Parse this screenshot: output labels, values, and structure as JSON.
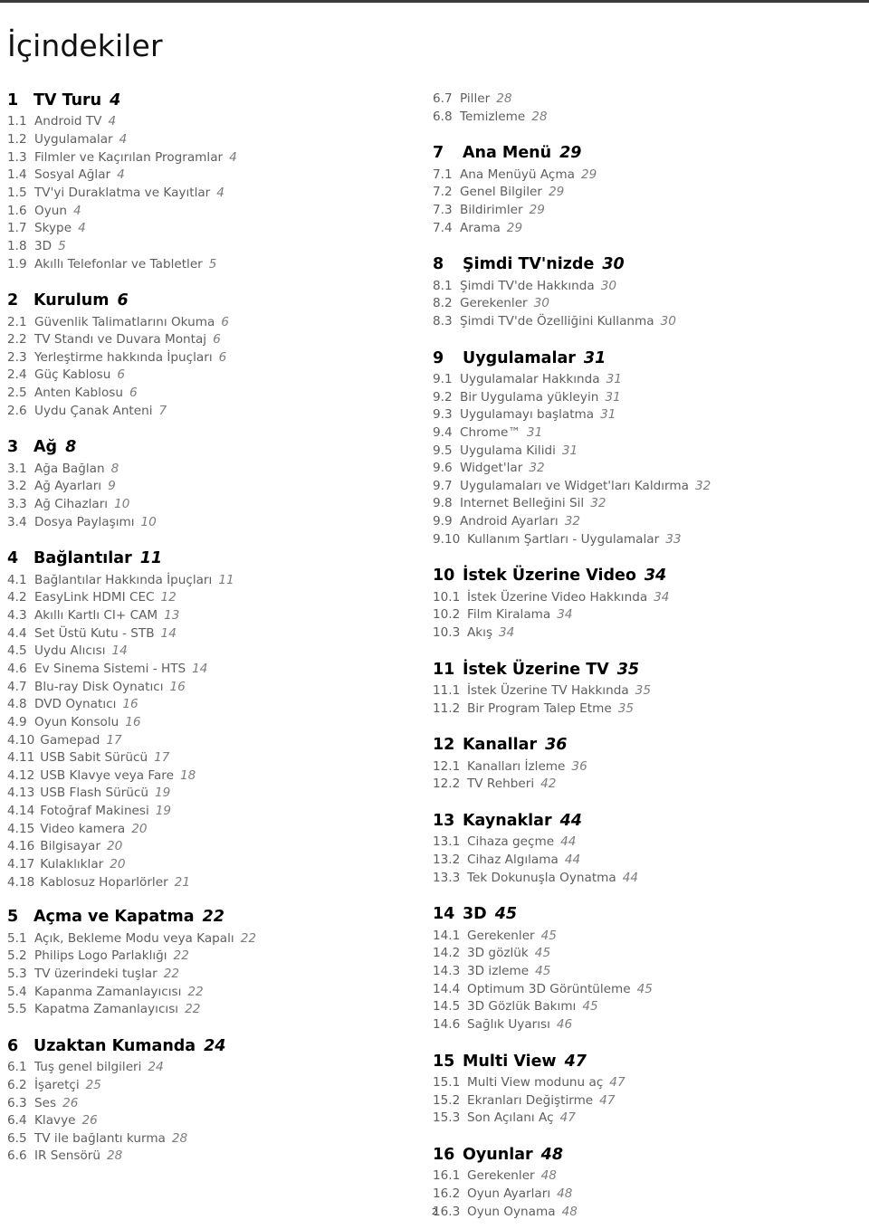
{
  "document": {
    "title": "İçindekiler",
    "page_number": "2"
  },
  "columns": [
    {
      "id": "left",
      "chapters": [
        {
          "num": "1",
          "title": "TV Turu",
          "page": "4",
          "entries": [
            {
              "num": "1.1",
              "title": "Android TV",
              "page": "4"
            },
            {
              "num": "1.2",
              "title": "Uygulamalar",
              "page": "4"
            },
            {
              "num": "1.3",
              "title": "Filmler ve Kaçırılan Programlar",
              "page": "4"
            },
            {
              "num": "1.4",
              "title": "Sosyal Ağlar",
              "page": "4"
            },
            {
              "num": "1.5",
              "title": "TV'yi Duraklatma ve Kayıtlar",
              "page": "4"
            },
            {
              "num": "1.6",
              "title": "Oyun",
              "page": "4"
            },
            {
              "num": "1.7",
              "title": "Skype",
              "page": "4"
            },
            {
              "num": "1.8",
              "title": "3D",
              "page": "5"
            },
            {
              "num": "1.9",
              "title": "Akıllı Telefonlar ve Tabletler",
              "page": "5"
            }
          ]
        },
        {
          "num": "2",
          "title": "Kurulum",
          "page": "6",
          "entries": [
            {
              "num": "2.1",
              "title": "Güvenlik Talimatlarını Okuma",
              "page": "6"
            },
            {
              "num": "2.2",
              "title": "TV Standı ve Duvara Montaj",
              "page": "6"
            },
            {
              "num": "2.3",
              "title": "Yerleştirme hakkında İpuçları",
              "page": "6"
            },
            {
              "num": "2.4",
              "title": "Güç Kablosu",
              "page": "6"
            },
            {
              "num": "2.5",
              "title": "Anten Kablosu",
              "page": "6"
            },
            {
              "num": "2.6",
              "title": "Uydu Çanak Anteni",
              "page": "7"
            }
          ]
        },
        {
          "num": "3",
          "title": "Ağ",
          "page": "8",
          "entries": [
            {
              "num": "3.1",
              "title": "Ağa Bağlan",
              "page": "8"
            },
            {
              "num": "3.2",
              "title": "Ağ Ayarları",
              "page": "9"
            },
            {
              "num": "3.3",
              "title": "Ağ Cihazları",
              "page": "10"
            },
            {
              "num": "3.4",
              "title": "Dosya Paylaşımı",
              "page": "10"
            }
          ]
        },
        {
          "num": "4",
          "title": "Bağlantılar",
          "page": "11",
          "entries": [
            {
              "num": "4.1",
              "title": "Bağlantılar Hakkında İpuçları",
              "page": "11"
            },
            {
              "num": "4.2",
              "title": "EasyLink HDMI CEC",
              "page": "12"
            },
            {
              "num": "4.3",
              "title": "Akıllı Kartlı CI+ CAM",
              "page": "13"
            },
            {
              "num": "4.4",
              "title": "Set Üstü Kutu - STB",
              "page": "14"
            },
            {
              "num": "4.5",
              "title": "Uydu Alıcısı",
              "page": "14"
            },
            {
              "num": "4.6",
              "title": "Ev Sinema Sistemi - HTS",
              "page": "14"
            },
            {
              "num": "4.7",
              "title": "Blu-ray Disk Oynatıcı",
              "page": "16"
            },
            {
              "num": "4.8",
              "title": "DVD Oynatıcı",
              "page": "16"
            },
            {
              "num": "4.9",
              "title": "Oyun Konsolu",
              "page": "16"
            },
            {
              "num": "4.10",
              "title": "Gamepad",
              "page": "17",
              "wide": true
            },
            {
              "num": "4.11",
              "title": "USB Sabit Sürücü",
              "page": "17",
              "wide": true
            },
            {
              "num": "4.12",
              "title": "USB Klavye veya Fare",
              "page": "18",
              "wide": true
            },
            {
              "num": "4.13",
              "title": "USB Flash Sürücü",
              "page": "19",
              "wide": true
            },
            {
              "num": "4.14",
              "title": "Fotoğraf Makinesi",
              "page": "19",
              "wide": true
            },
            {
              "num": "4.15",
              "title": "Video kamera",
              "page": "20",
              "wide": true
            },
            {
              "num": "4.16",
              "title": "Bilgisayar",
              "page": "20",
              "wide": true
            },
            {
              "num": "4.17",
              "title": "Kulaklıklar",
              "page": "20",
              "wide": true
            },
            {
              "num": "4.18",
              "title": "Kablosuz Hoparlörler",
              "page": "21",
              "wide": true
            }
          ]
        },
        {
          "num": "5",
          "title": "Açma ve Kapatma",
          "page": "22",
          "tight": true,
          "entries": [
            {
              "num": "5.1",
              "title": "Açık, Bekleme Modu veya Kapalı",
              "page": "22"
            },
            {
              "num": "5.2",
              "title": "Philips Logo Parlaklığı",
              "page": "22"
            },
            {
              "num": "5.3",
              "title": "TV üzerindeki tuşlar",
              "page": "22"
            },
            {
              "num": "5.4",
              "title": "Kapanma Zamanlayıcısı",
              "page": "22"
            },
            {
              "num": "5.5",
              "title": "Kapatma Zamanlayıcısı",
              "page": "22"
            }
          ]
        },
        {
          "num": "6",
          "title": "Uzaktan Kumanda",
          "page": "24",
          "entries": [
            {
              "num": "6.1",
              "title": "Tuş genel bilgileri",
              "page": "24"
            },
            {
              "num": "6.2",
              "title": "İşaretçi",
              "page": "25"
            },
            {
              "num": "6.3",
              "title": "Ses",
              "page": "26"
            },
            {
              "num": "6.4",
              "title": "Klavye",
              "page": "26"
            },
            {
              "num": "6.5",
              "title": "TV ile bağlantı kurma",
              "page": "28"
            },
            {
              "num": "6.6",
              "title": "IR Sensörü",
              "page": "28"
            }
          ]
        }
      ]
    },
    {
      "id": "right",
      "orphan_entries": [
        {
          "num": "6.7",
          "title": "Piller",
          "page": "28"
        },
        {
          "num": "6.8",
          "title": "Temizleme",
          "page": "28"
        }
      ],
      "chapters": [
        {
          "num": "7",
          "title": "Ana Menü",
          "page": "29",
          "entries": [
            {
              "num": "7.1",
              "title": "Ana Menüyü Açma",
              "page": "29"
            },
            {
              "num": "7.2",
              "title": "Genel Bilgiler",
              "page": "29"
            },
            {
              "num": "7.3",
              "title": "Bildirimler",
              "page": "29"
            },
            {
              "num": "7.4",
              "title": "Arama",
              "page": "29"
            }
          ]
        },
        {
          "num": "8",
          "title": "Şimdi TV'nizde",
          "page": "30",
          "entries": [
            {
              "num": "8.1",
              "title": "Şimdi TV'de Hakkında",
              "page": "30"
            },
            {
              "num": "8.2",
              "title": "Gerekenler",
              "page": "30"
            },
            {
              "num": "8.3",
              "title": "Şimdi TV'de Özelliğini Kullanma",
              "page": "30"
            }
          ]
        },
        {
          "num": "9",
          "title": "Uygulamalar",
          "page": "31",
          "entries": [
            {
              "num": "9.1",
              "title": "Uygulamalar Hakkında",
              "page": "31"
            },
            {
              "num": "9.2",
              "title": "Bir Uygulama yükleyin",
              "page": "31"
            },
            {
              "num": "9.3",
              "title": "Uygulamayı başlatma",
              "page": "31"
            },
            {
              "num": "9.4",
              "title": "Chrome™",
              "page": "31"
            },
            {
              "num": "9.5",
              "title": "Uygulama Kilidi",
              "page": "31"
            },
            {
              "num": "9.6",
              "title": "Widget'lar",
              "page": "32"
            },
            {
              "num": "9.7",
              "title": "Uygulamaları ve Widget'ları Kaldırma",
              "page": "32"
            },
            {
              "num": "9.8",
              "title": "Internet Belleğini Sil",
              "page": "32"
            },
            {
              "num": "9.9",
              "title": "Android Ayarları",
              "page": "32"
            },
            {
              "num": "9.10",
              "title": "Kullanım Şartları - Uygulamalar",
              "page": "33",
              "wide": true
            }
          ]
        },
        {
          "num": "10",
          "title": "İstek Üzerine Video",
          "page": "34",
          "entries": [
            {
              "num": "10.1",
              "title": "İstek Üzerine Video Hakkında",
              "page": "34",
              "wide": true
            },
            {
              "num": "10.2",
              "title": "Film Kiralama",
              "page": "34",
              "wide": true
            },
            {
              "num": "10.3",
              "title": "Akış",
              "page": "34",
              "wide": true
            }
          ]
        },
        {
          "num": "11",
          "title": "İstek Üzerine TV",
          "page": "35",
          "entries": [
            {
              "num": "11.1",
              "title": "İstek Üzerine TV Hakkında",
              "page": "35",
              "wide": true
            },
            {
              "num": "11.2",
              "title": "Bir Program Talep Etme",
              "page": "35",
              "wide": true
            }
          ]
        },
        {
          "num": "12",
          "title": "Kanallar",
          "page": "36",
          "entries": [
            {
              "num": "12.1",
              "title": "Kanalları İzleme",
              "page": "36",
              "wide": true
            },
            {
              "num": "12.2",
              "title": "TV Rehberi",
              "page": "42",
              "wide": true
            }
          ]
        },
        {
          "num": "13",
          "title": "Kaynaklar",
          "page": "44",
          "entries": [
            {
              "num": "13.1",
              "title": "Cihaza geçme",
              "page": "44",
              "wide": true
            },
            {
              "num": "13.2",
              "title": "Cihaz Algılama",
              "page": "44",
              "wide": true
            },
            {
              "num": "13.3",
              "title": "Tek Dokunuşla Oynatma",
              "page": "44",
              "wide": true
            }
          ]
        },
        {
          "num": "14",
          "title": "3D",
          "page": "45",
          "entries": [
            {
              "num": "14.1",
              "title": "Gerekenler",
              "page": "45",
              "wide": true
            },
            {
              "num": "14.2",
              "title": "3D gözlük",
              "page": "45",
              "wide": true
            },
            {
              "num": "14.3",
              "title": "3D izleme",
              "page": "45",
              "wide": true
            },
            {
              "num": "14.4",
              "title": "Optimum 3D Görüntüleme",
              "page": "45",
              "wide": true
            },
            {
              "num": "14.5",
              "title": "3D Gözlük Bakımı",
              "page": "45",
              "wide": true
            },
            {
              "num": "14.6",
              "title": "Sağlık Uyarısı",
              "page": "46",
              "wide": true
            }
          ]
        },
        {
          "num": "15",
          "title": "Multi View",
          "page": "47",
          "entries": [
            {
              "num": "15.1",
              "title": "Multi View modunu aç",
              "page": "47",
              "wide": true
            },
            {
              "num": "15.2",
              "title": "Ekranları Değiştirme",
              "page": "47",
              "wide": true
            },
            {
              "num": "15.3",
              "title": "Son Açılanı Aç",
              "page": "47",
              "wide": true
            }
          ]
        },
        {
          "num": "16",
          "title": "Oyunlar",
          "page": "48",
          "entries": [
            {
              "num": "16.1",
              "title": "Gerekenler",
              "page": "48",
              "wide": true
            },
            {
              "num": "16.2",
              "title": "Oyun Ayarları",
              "page": "48",
              "wide": true
            },
            {
              "num": "16.3",
              "title": "Oyun Oynama",
              "page": "48",
              "wide": true
            }
          ]
        }
      ]
    }
  ]
}
